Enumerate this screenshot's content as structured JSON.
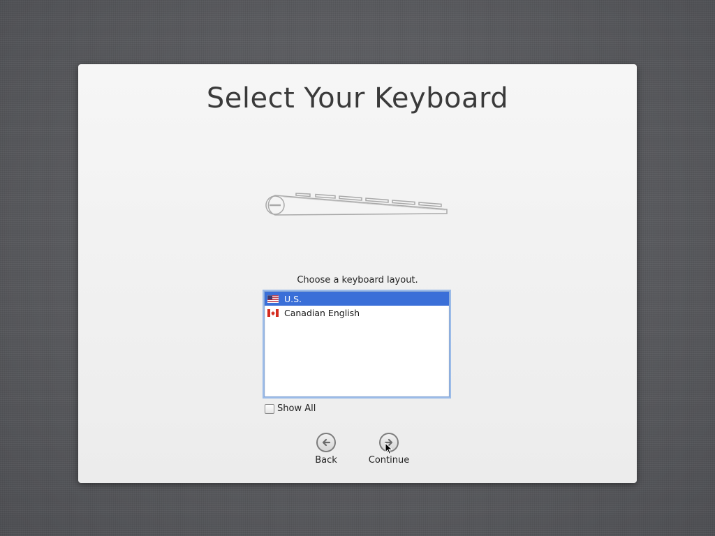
{
  "dialog": {
    "title": "Select Your Keyboard",
    "prompt": "Choose a keyboard layout.",
    "layouts": [
      {
        "label": "U.S.",
        "icon": "us-flag-icon",
        "selected": true
      },
      {
        "label": "Canadian English",
        "icon": "canada-flag-icon",
        "selected": false
      }
    ],
    "show_all": {
      "label": "Show All",
      "checked": false
    },
    "buttons": {
      "back_label": "Back",
      "continue_label": "Continue"
    }
  },
  "colors": {
    "selection": "#3a6fd8",
    "focus_ring": "#9bbbe8",
    "background": "#5b5c60"
  }
}
